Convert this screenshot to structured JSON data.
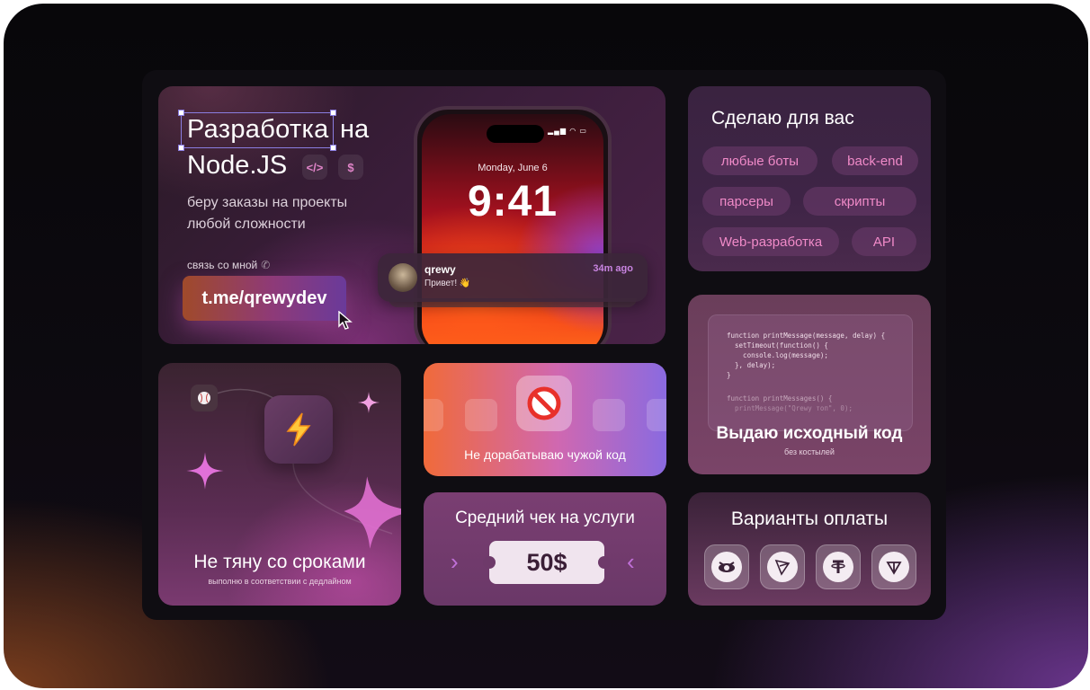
{
  "hero": {
    "title_line1": "Разработка",
    "title_line1b": "на",
    "title_line2": "Node.JS",
    "code_chip": "</>",
    "dollar_chip": "$",
    "subtitle_line1": "беру заказы на проекты",
    "subtitle_line2": "любой сложности",
    "contact_label": "связь со мной",
    "telegram_link": "t.me/qrewydev"
  },
  "phone": {
    "date": "Monday, June 6",
    "time": "9:41",
    "notification": {
      "name": "qrewy",
      "message": "Привет! 👋",
      "time": "34m ago"
    }
  },
  "services": {
    "title": "Сделаю для вас",
    "tags": [
      "любые боты",
      "back-end",
      "парсеры",
      "скрипты",
      "Web-разработка",
      "API"
    ]
  },
  "source_code": {
    "lines": [
      "function printMessage(message, delay) {",
      "  setTimeout(function() {",
      "    console.log(message);",
      "  }, delay);",
      "}",
      "",
      "function printMessages() {",
      "  printMessage(\"Qrewy топ\", 0);"
    ],
    "title": "Выдаю исходный код",
    "subtitle": "без костылей"
  },
  "deadlines": {
    "title": "Не тяну со сроками",
    "subtitle": "выполню в соответствии с дедлайном"
  },
  "no_foreign_code": {
    "title": "Не дорабатываю чужой код"
  },
  "average_check": {
    "title": "Средний чек на услуги",
    "value": "50$"
  },
  "payments": {
    "title": "Варианты оплаты",
    "methods": [
      "cryptobot-icon",
      "tron-icon",
      "tether-icon",
      "toncoin-icon"
    ]
  },
  "colors": {
    "accent_pink": "#f08ac8",
    "accent_purple": "#8a6ae0",
    "accent_orange": "#f06a3a"
  }
}
